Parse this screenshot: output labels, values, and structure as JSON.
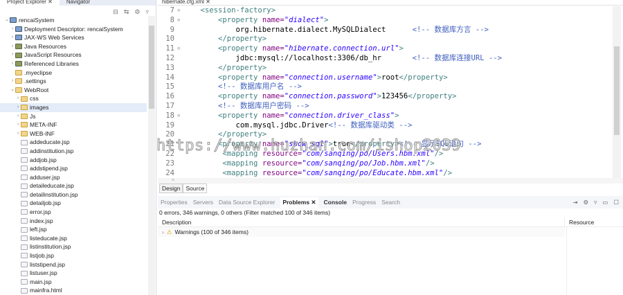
{
  "left": {
    "tabs": [
      "Project Explorer ✕",
      "Navigator"
    ],
    "tree": [
      {
        "label": "rencaiSystem",
        "depth": 0,
        "tw": "v",
        "icon": "proj"
      },
      {
        "label": "Deployment Descriptor: rencaiSystem",
        "depth": 1,
        "tw": ">",
        "icon": "proj"
      },
      {
        "label": "JAX-WS Web Services",
        "depth": 1,
        "tw": ">",
        "icon": "proj"
      },
      {
        "label": "Java Resources",
        "depth": 1,
        "tw": ">",
        "icon": "lib"
      },
      {
        "label": "JavaScript Resources",
        "depth": 1,
        "tw": ">",
        "icon": "lib"
      },
      {
        "label": "Referenced Libraries",
        "depth": 1,
        "tw": ">",
        "icon": "lib"
      },
      {
        "label": ".myeclipse",
        "depth": 1,
        "tw": "",
        "icon": "folder"
      },
      {
        "label": ".settings",
        "depth": 1,
        "tw": ">",
        "icon": "folder"
      },
      {
        "label": "WebRoot",
        "depth": 1,
        "tw": "v",
        "icon": "folder"
      },
      {
        "label": "css",
        "depth": 2,
        "tw": ">",
        "icon": "folder"
      },
      {
        "label": "images",
        "depth": 2,
        "tw": ">",
        "icon": "folder",
        "selected": true
      },
      {
        "label": "Js",
        "depth": 2,
        "tw": ">",
        "icon": "folder"
      },
      {
        "label": "META-INF",
        "depth": 2,
        "tw": ">",
        "icon": "folder"
      },
      {
        "label": "WEB-INF",
        "depth": 2,
        "tw": ">",
        "icon": "folder"
      },
      {
        "label": "addeducate.jsp",
        "depth": 2,
        "tw": "",
        "icon": "file"
      },
      {
        "label": "addinstitution.jsp",
        "depth": 2,
        "tw": "",
        "icon": "file"
      },
      {
        "label": "addjob.jsp",
        "depth": 2,
        "tw": "",
        "icon": "file"
      },
      {
        "label": "addstipend.jsp",
        "depth": 2,
        "tw": "",
        "icon": "file"
      },
      {
        "label": "adduser.jsp",
        "depth": 2,
        "tw": "",
        "icon": "file"
      },
      {
        "label": "detaileducate.jsp",
        "depth": 2,
        "tw": "",
        "icon": "file"
      },
      {
        "label": "detailinstitution.jsp",
        "depth": 2,
        "tw": "",
        "icon": "file"
      },
      {
        "label": "detailjob.jsp",
        "depth": 2,
        "tw": "",
        "icon": "file"
      },
      {
        "label": "error.jsp",
        "depth": 2,
        "tw": "",
        "icon": "file"
      },
      {
        "label": "index.jsp",
        "depth": 2,
        "tw": "",
        "icon": "file"
      },
      {
        "label": "left.jsp",
        "depth": 2,
        "tw": "",
        "icon": "file"
      },
      {
        "label": "listeducate.jsp",
        "depth": 2,
        "tw": "",
        "icon": "file"
      },
      {
        "label": "listinstitution.jsp",
        "depth": 2,
        "tw": "",
        "icon": "file"
      },
      {
        "label": "listjob.jsp",
        "depth": 2,
        "tw": "",
        "icon": "file"
      },
      {
        "label": "liststipend.jsp",
        "depth": 2,
        "tw": "",
        "icon": "file"
      },
      {
        "label": "listuser.jsp",
        "depth": 2,
        "tw": "",
        "icon": "file"
      },
      {
        "label": "main.jsp",
        "depth": 2,
        "tw": "",
        "icon": "file"
      },
      {
        "label": "mainfra.html",
        "depth": 2,
        "tw": "",
        "icon": "file"
      }
    ]
  },
  "editor": {
    "tab": "hibernate.cfg.xml ✕",
    "lines": [
      {
        "n": "7",
        "fold": true,
        "toks": [
          [
            "    ",
            "txt"
          ],
          [
            "<session-factory>",
            "tag"
          ]
        ]
      },
      {
        "n": "8",
        "fold": true,
        "toks": [
          [
            "        ",
            "txt"
          ],
          [
            "<property ",
            "tag"
          ],
          [
            "name=",
            "attr"
          ],
          [
            "\"dialect\"",
            "val"
          ],
          [
            ">",
            "tag"
          ]
        ]
      },
      {
        "n": "9",
        "toks": [
          [
            "            org.hibernate.dialect.MySQLDialect      ",
            "txt"
          ],
          [
            "<!-- 数据库方言 -->",
            "cmt"
          ]
        ]
      },
      {
        "n": "10",
        "toks": [
          [
            "        ",
            "txt"
          ],
          [
            "</property>",
            "tag"
          ]
        ]
      },
      {
        "n": "11",
        "fold": true,
        "toks": [
          [
            "        ",
            "txt"
          ],
          [
            "<property ",
            "tag"
          ],
          [
            "name=",
            "attr"
          ],
          [
            "\"hibernate.connection.url\"",
            "val"
          ],
          [
            ">",
            "tag"
          ]
        ]
      },
      {
        "n": "12",
        "toks": [
          [
            "            jdbc:mysql://localhost:3306/db_hr       ",
            "txt"
          ],
          [
            "<!-- 数据库连接URL -->",
            "cmt"
          ]
        ]
      },
      {
        "n": "13",
        "toks": [
          [
            "        ",
            "txt"
          ],
          [
            "</property>",
            "tag"
          ]
        ]
      },
      {
        "n": "14",
        "toks": [
          [
            "        ",
            "txt"
          ],
          [
            "<property ",
            "tag"
          ],
          [
            "name=",
            "attr"
          ],
          [
            "\"connection.username\"",
            "val"
          ],
          [
            ">",
            "tag"
          ],
          [
            "root",
            "txt"
          ],
          [
            "</property>",
            "tag"
          ]
        ]
      },
      {
        "n": "15",
        "toks": [
          [
            "        ",
            "txt"
          ],
          [
            "<!-- 数据库用户名 -->",
            "cmt"
          ]
        ]
      },
      {
        "n": "16",
        "toks": [
          [
            "        ",
            "txt"
          ],
          [
            "<property ",
            "tag"
          ],
          [
            "name=",
            "attr"
          ],
          [
            "\"connection.password\"",
            "val"
          ],
          [
            ">",
            "tag"
          ],
          [
            "123456",
            "txt"
          ],
          [
            "</property>",
            "tag"
          ]
        ]
      },
      {
        "n": "17",
        "toks": [
          [
            "        ",
            "txt"
          ],
          [
            "<!-- 数据库用户密码 -->",
            "cmt"
          ]
        ]
      },
      {
        "n": "18",
        "fold": true,
        "toks": [
          [
            "        ",
            "txt"
          ],
          [
            "<property ",
            "tag"
          ],
          [
            "name=",
            "attr"
          ],
          [
            "\"connection.driver_class\"",
            "val"
          ],
          [
            ">",
            "tag"
          ]
        ]
      },
      {
        "n": "19",
        "toks": [
          [
            "            com.mysql.jdbc.Driver",
            "txt"
          ],
          [
            "<!-- 数据库驱动类 -->",
            "cmt"
          ]
        ]
      },
      {
        "n": "20",
        "toks": [
          [
            "        ",
            "txt"
          ],
          [
            "</property>",
            "tag"
          ]
        ]
      },
      {
        "n": "21",
        "toks": [
          [
            "        ",
            "txt"
          ],
          [
            "<property ",
            "tag"
          ],
          [
            "name=",
            "attr"
          ],
          [
            "\"show_sql\"",
            "val"
          ],
          [
            ">",
            "tag"
          ],
          [
            "true",
            "txt"
          ],
          [
            "</property>",
            "tag"
          ],
          [
            "<!-- 显示SQL语句 -->",
            "cmt"
          ]
        ]
      },
      {
        "n": "22",
        "toks": [
          [
            "         ",
            "txt"
          ],
          [
            "<mapping ",
            "tag"
          ],
          [
            "resource=",
            "attr"
          ],
          [
            "\"com/sanqing/po/Users.hbm.xml\"",
            "val"
          ],
          [
            "/>",
            "tag"
          ]
        ]
      },
      {
        "n": "23",
        "toks": [
          [
            "         ",
            "txt"
          ],
          [
            "<mapping ",
            "tag"
          ],
          [
            "resource=",
            "attr"
          ],
          [
            "\"com/sanqing/po/Job.hbm.xml\"",
            "val"
          ],
          [
            "/>",
            "tag"
          ]
        ]
      },
      {
        "n": "24",
        "toks": [
          [
            "         ",
            "txt"
          ],
          [
            "<mapping ",
            "tag"
          ],
          [
            "resource=",
            "attr"
          ],
          [
            "\"com/sanqing/po/Educate.hbm.xml\"",
            "val"
          ],
          [
            "/>",
            "tag"
          ]
        ]
      }
    ],
    "design_tab": "Design",
    "source_tab": "Source"
  },
  "bottom": {
    "tabs": [
      "Properties",
      "Servers",
      "Data Source Explorer",
      "Problems ✕",
      "Console",
      "Progress",
      "Search"
    ],
    "active_tab": 3,
    "status": "0 errors, 346 warnings, 0 others (Filter matched 100 of 346 items)",
    "col_description": "Description",
    "col_resource": "Resource",
    "warnings_row": "Warnings (100 of 346 items)"
  },
  "watermark": "https://www.huzhan.com/ishop2039"
}
